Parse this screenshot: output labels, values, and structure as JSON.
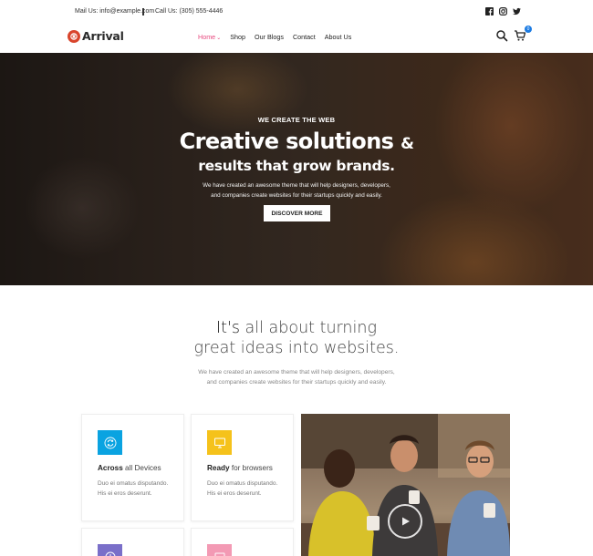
{
  "topbar": {
    "mail": "Mail Us: info@example.com",
    "call": "Call Us: (305) 555-4446",
    "social": [
      "facebook-icon",
      "instagram-icon",
      "twitter-icon"
    ]
  },
  "nav": {
    "brand": "Arrival",
    "menu": [
      {
        "label": "Home"
      },
      {
        "label": "Shop"
      },
      {
        "label": "Our Blogs"
      },
      {
        "label": "Contact"
      },
      {
        "label": "About Us"
      }
    ],
    "cart_count": "0",
    "active_color": "#e7487e",
    "badge_color": "#1b7be3"
  },
  "hero": {
    "eyebrow": "WE CREATE THE WEB",
    "headline_line1": "Creative solutions",
    "headline_amp": "&",
    "headline_line2": "results that grow brands.",
    "desc_line1": "We have created an awesome theme that will help designers, developers,",
    "desc_line2": "and companies create websites for their startups quickly and easily.",
    "button": "DISCOVER MORE"
  },
  "about": {
    "title_strong": "It's",
    "title_rest": " all about turning",
    "title_line2": "great ideas into websites.",
    "desc_line1": "We have created an awesome theme that will help designers, developers,",
    "desc_line2": "and companies create websites for their startups quickly and easily."
  },
  "features": [
    {
      "bold": "Across",
      "rest": " all Devices",
      "text": "Duo ei omatus disputando. His ei eros deserunt.",
      "color": "#0aa3e1",
      "icon": "sync-icon"
    },
    {
      "bold": "Ready",
      "rest": " for browsers",
      "text": "Duo ei omatus disputando. His ei eros deserunt.",
      "color": "#f5c21b",
      "icon": "monitor-icon"
    },
    {
      "icon": "clock-icon",
      "color": "#7a6fc9"
    },
    {
      "icon": "image-icon",
      "color": "#f39ab4"
    }
  ]
}
